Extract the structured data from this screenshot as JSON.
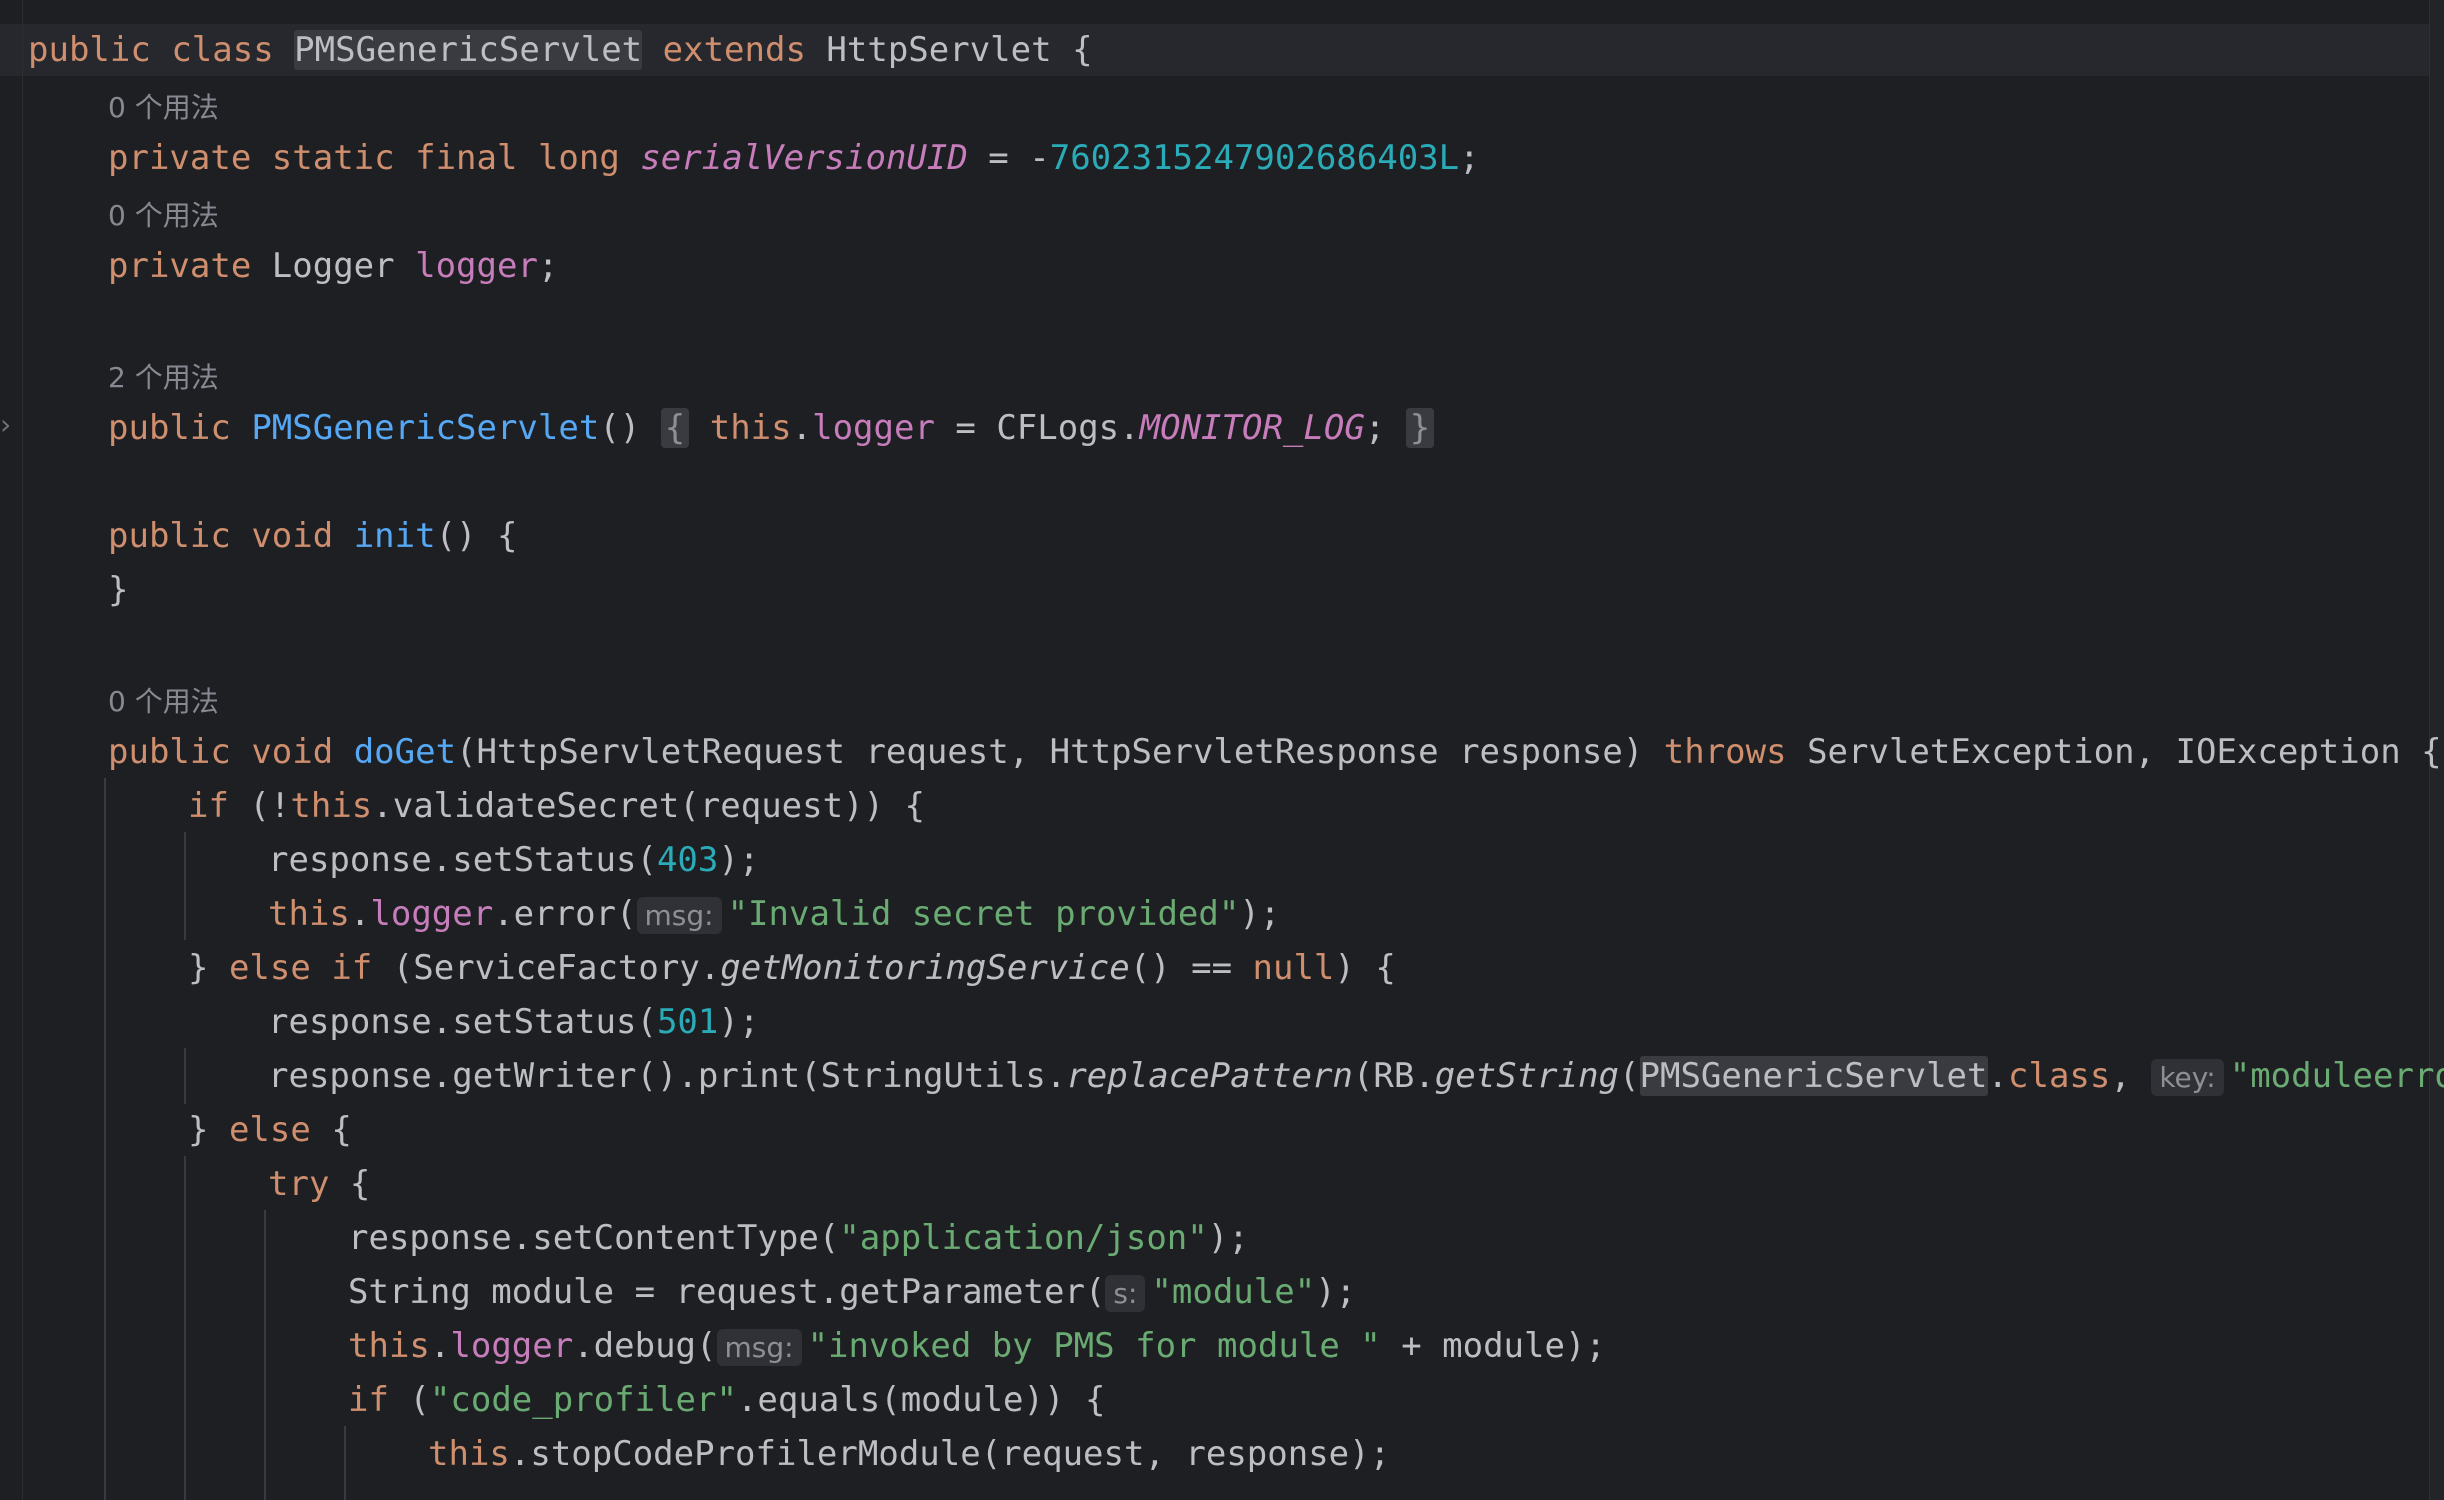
{
  "editor": {
    "usage_hints": {
      "zero": "0 个用法",
      "two": "2 个用法"
    },
    "keywords": {
      "public": "public",
      "class": "class",
      "extends": "extends",
      "private": "private",
      "static": "static",
      "final": "final",
      "long": "long",
      "void": "void",
      "throws": "throws",
      "if": "if",
      "else": "else",
      "try": "try",
      "this": "this",
      "null": "null"
    },
    "line1": {
      "class_name": "PMSGenericServlet",
      "superclass": "HttpServlet",
      "brace": " {"
    },
    "line3": {
      "field": "serialVersionUID",
      "eq": " = -",
      "value": "7602315247902686403L",
      "semi": ";"
    },
    "line5": {
      "type": "Logger",
      "field": "logger",
      "semi": ";"
    },
    "line7": {
      "ctor": "PMSGenericServlet",
      "parens": "()",
      "fold_open": "{",
      "dot": ".",
      "field": "logger",
      "assign": " = CFLogs.",
      "const": "MONITOR_LOG",
      "semi": ";",
      "fold_close": "}"
    },
    "line8": {
      "method": "init",
      "rest": "() {"
    },
    "line9": {
      "text": "}"
    },
    "line11": {
      "method": "doGet",
      "params": "(HttpServletRequest request, HttpServletResponse response) ",
      "exceptions": " ServletException, IOException {"
    },
    "line12": {
      "open": " (!",
      "rest": ".validateSecret(request)) {"
    },
    "line13": {
      "pre": "response.setStatus(",
      "num": "403",
      "post": ");"
    },
    "line14": {
      "dot": ".",
      "field": "logger",
      "call": ".error(",
      "hint": "msg:",
      "str": "\"Invalid secret provided\"",
      "post": ");"
    },
    "line15": {
      "open": "} ",
      "mid": " (ServiceFactory.",
      "call": "getMonitoringService",
      "cmp": "() == ",
      "post": ") {"
    },
    "line16": {
      "pre": "response.setStatus(",
      "num": "501",
      "post": ");"
    },
    "line17": {
      "pre": "response.getWriter().print(StringUtils.",
      "call1": "replacePattern",
      "mid": "(RB.",
      "call2": "getString",
      "paren": "(",
      "cls": "PMSGenericServlet",
      "dot": ".",
      "kw_class": "class",
      "comma": ", ",
      "hint": "key:",
      "str": "\"moduleerror\""
    },
    "line18": {
      "open": "} ",
      "post": " {"
    },
    "line19": {
      "post": " {"
    },
    "line20": {
      "pre": "response.setContentType(",
      "str": "\"application/json\"",
      "post": ");"
    },
    "line21": {
      "pre": "String module = request.getParameter(",
      "hint": "s:",
      "str": "\"module\"",
      "post": ");"
    },
    "line22": {
      "dot": ".",
      "field": "logger",
      "call": ".debug(",
      "hint": "msg:",
      "str": "\"invoked by PMS for module \"",
      "post": " + module);"
    },
    "line23": {
      "open": " (",
      "str": "\"code_profiler\"",
      "post": ".equals(module)) {"
    },
    "line24": {
      "rest": ".stopCodeProfilerModule(request, response);"
    }
  }
}
